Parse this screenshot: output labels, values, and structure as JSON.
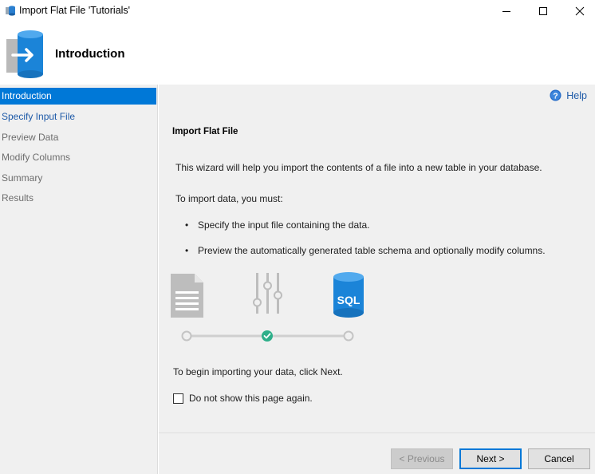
{
  "window": {
    "title": "Import Flat File 'Tutorials'",
    "controls": {
      "minimize_icon": "minimize-icon",
      "maximize_icon": "maximize-icon",
      "close_icon": "close-icon"
    }
  },
  "header": {
    "title": "Introduction",
    "icon": "import-database-icon"
  },
  "nav": {
    "items": [
      {
        "label": "Introduction",
        "state": "active"
      },
      {
        "label": "Specify Input File",
        "state": "link"
      },
      {
        "label": "Preview Data",
        "state": "disabled"
      },
      {
        "label": "Modify Columns",
        "state": "disabled"
      },
      {
        "label": "Summary",
        "state": "disabled"
      },
      {
        "label": "Results",
        "state": "disabled"
      }
    ]
  },
  "help": {
    "label": "Help",
    "icon": "help-icon"
  },
  "main": {
    "section_title": "Import Flat File",
    "intro": "This wizard will help you import the contents of a file into a new table in your database.",
    "must": "To import data, you must:",
    "bullets": [
      "Specify the input file containing the data.",
      "Preview the automatically generated table schema and optionally modify columns."
    ],
    "illustration": {
      "steps": [
        "document-icon",
        "sliders-icon",
        "sql-database-icon"
      ],
      "sql_label": "SQL",
      "progress_step_checked": 2
    },
    "begin": "To begin importing your data, click Next.",
    "checkbox_label": "Do not show this page again.",
    "checkbox_checked": false
  },
  "footer": {
    "previous": "< Previous",
    "next": "Next >",
    "cancel": "Cancel"
  },
  "colors": {
    "accent": "#0078d7",
    "nav_link": "#1e5aa8",
    "panel_bg": "#f0f0f0",
    "illustration_gray": "#bdbdbd",
    "check_green": "#2eaf8a"
  }
}
